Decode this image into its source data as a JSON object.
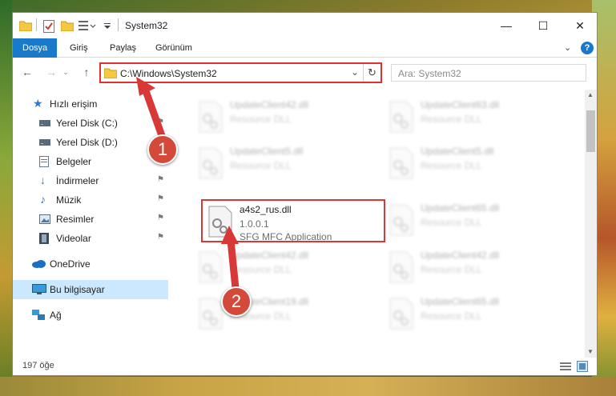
{
  "window": {
    "title": "System32",
    "controls": {
      "minimize": "—",
      "maximize": "☐",
      "close": "✕"
    }
  },
  "ribbon": {
    "tabs": [
      {
        "label": "Dosya"
      },
      {
        "label": "Giriş"
      },
      {
        "label": "Paylaş"
      },
      {
        "label": "Görünüm"
      }
    ],
    "collapse_glyph": "⌄",
    "help_glyph": "?"
  },
  "address_bar": {
    "path": "C:\\Windows\\System32",
    "search_placeholder": "Ara: System32"
  },
  "sidebar": {
    "items": [
      {
        "label": "Hızlı erişim",
        "icon": "star-icon"
      },
      {
        "label": "Yerel Disk (C:)",
        "icon": "drive-icon"
      },
      {
        "label": "Yerel Disk (D:)",
        "icon": "drive-icon"
      },
      {
        "label": "Belgeler",
        "icon": "documents-icon"
      },
      {
        "label": "İndirmeler",
        "icon": "download-icon"
      },
      {
        "label": "Müzik",
        "icon": "music-icon"
      },
      {
        "label": "Resimler",
        "icon": "pictures-icon"
      },
      {
        "label": "Videolar",
        "icon": "video-icon"
      },
      {
        "label": "OneDrive",
        "icon": "cloud-icon"
      },
      {
        "label": "Bu bilgisayar",
        "icon": "computer-icon",
        "selected": true
      },
      {
        "label": "Ağ",
        "icon": "network-icon"
      }
    ]
  },
  "files": {
    "left": [
      {
        "name": "UpdateClient42.dll",
        "line2": "Resource DLL"
      },
      {
        "name": "UpdateClient5.dll",
        "line2": "Resource DLL"
      },
      {
        "name": "a4s2_rus.dll",
        "line2": "1.0.0.1",
        "line3": "SFG MFC Application"
      },
      {
        "name": "UpdateClient42.dll",
        "line2": "Resource DLL"
      },
      {
        "name": "UpdateClient19.dll",
        "line2": "Resource DLL"
      }
    ],
    "right": [
      {
        "name": "UpdateClient63.dll",
        "line2": "Resource DLL"
      },
      {
        "name": "UpdateClient5.dll",
        "line2": "Resource DLL"
      },
      {
        "name": "UpdateClient65.dll",
        "line2": "Resource DLL"
      },
      {
        "name": "UpdateClient42.dll",
        "line2": "Resource DLL"
      },
      {
        "name": "UpdateClient65.dll",
        "line2": "Resource DLL"
      }
    ]
  },
  "status": {
    "item_count": "197 öğe"
  },
  "callouts": [
    {
      "number": "1"
    },
    {
      "number": "2"
    }
  ],
  "colors": {
    "accent": "#1979ca",
    "highlight": "#d83838",
    "selection": "#cce8ff"
  }
}
